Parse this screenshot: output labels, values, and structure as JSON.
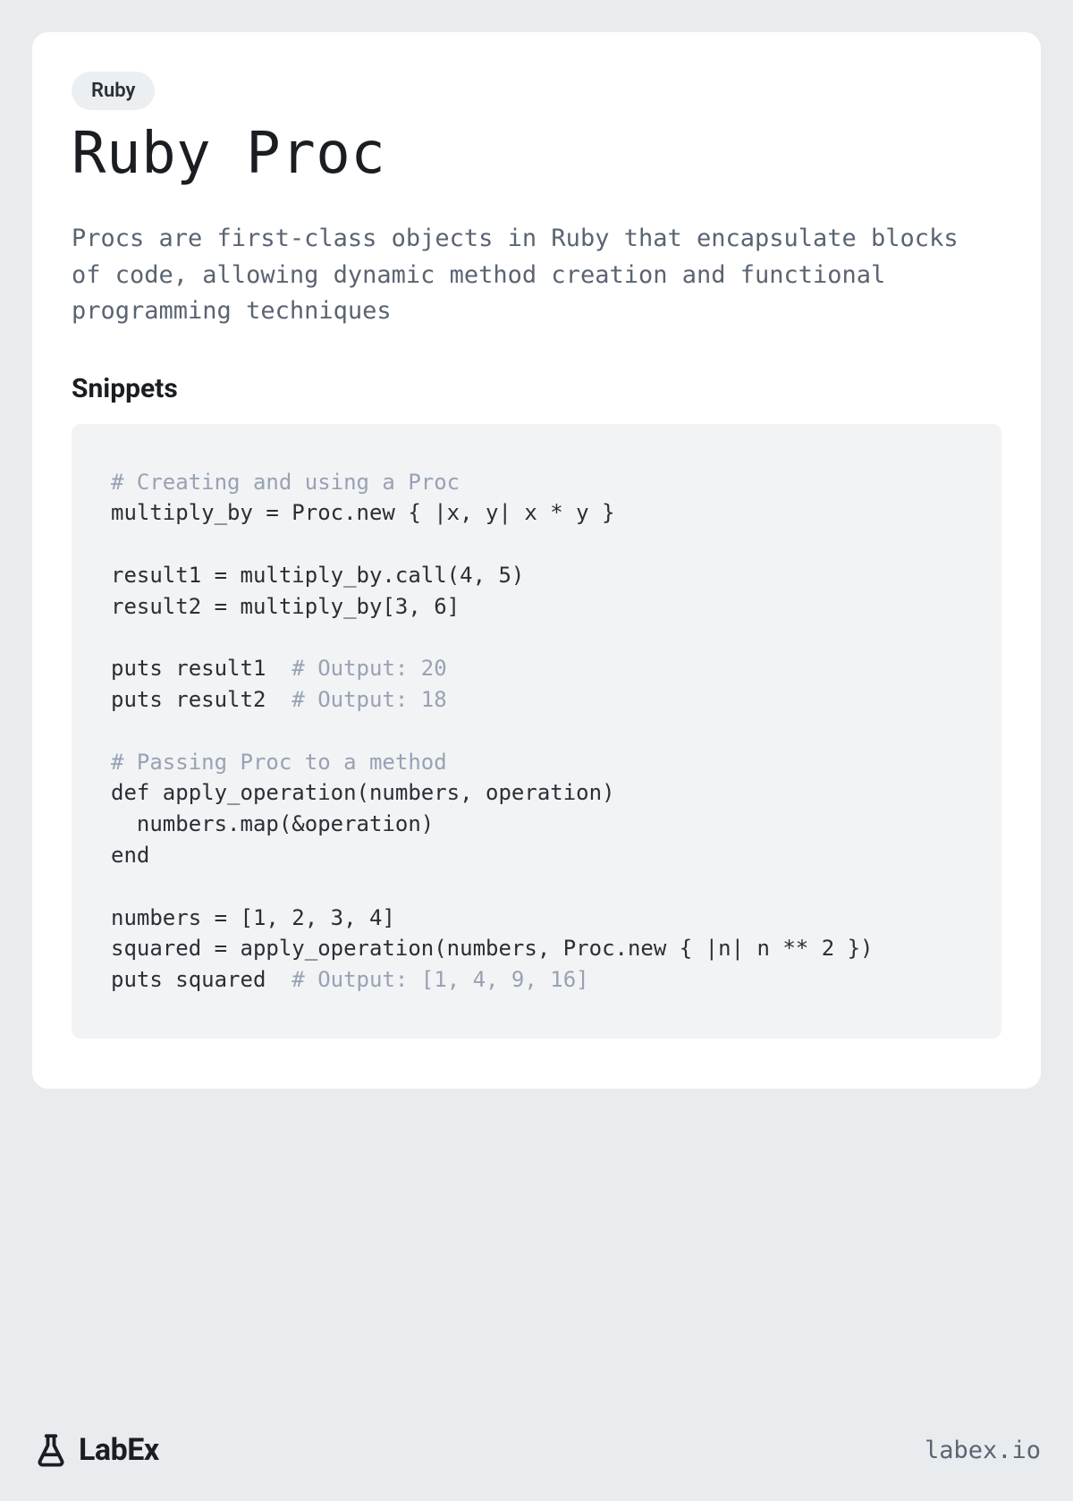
{
  "badge": "Ruby",
  "title": "Ruby Proc",
  "description": "Procs are first-class objects in Ruby that encapsulate blocks of code, allowing dynamic method creation and functional programming techniques",
  "section_heading": "Snippets",
  "code": {
    "l1_comment": "# Creating and using a Proc",
    "l2": "multiply_by = Proc.new { |x, y| x * y }",
    "l3": "",
    "l4": "result1 = multiply_by.call(4, 5)",
    "l5": "result2 = multiply_by[3, 6]",
    "l6": "",
    "l7a": "puts result1  ",
    "l7_comment": "# Output: 20",
    "l8a": "puts result2  ",
    "l8_comment": "# Output: 18",
    "l9": "",
    "l10_comment": "# Passing Proc to a method",
    "l11": "def apply_operation(numbers, operation)",
    "l12": "  numbers.map(&operation)",
    "l13": "end",
    "l14": "",
    "l15": "numbers = [1, 2, 3, 4]",
    "l16": "squared = apply_operation(numbers, Proc.new { |n| n ** 2 })",
    "l17a": "puts squared  ",
    "l17_comment": "# Output: [1, 4, 9, 16]"
  },
  "brand": "LabEx",
  "site": "labex.io"
}
